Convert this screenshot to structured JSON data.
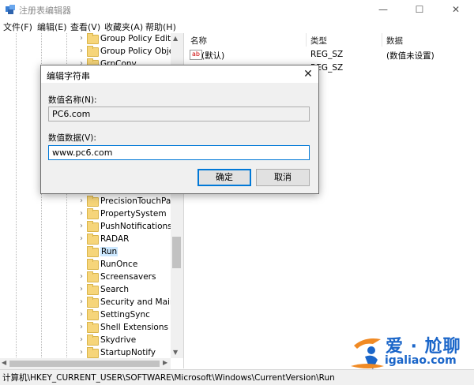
{
  "window": {
    "title": "注册表编辑器",
    "minimize_glyph": "—",
    "maximize_glyph": "☐",
    "close_glyph": "✕"
  },
  "menu": [
    "文件(F)",
    "编辑(E)",
    "查看(V)",
    "收藏夹(A)",
    "帮助(H)"
  ],
  "tree": {
    "items_top": [
      "Group Policy Editor",
      "Group Policy Objec",
      "GrpConv"
    ],
    "items_bottom": [
      {
        "label": "PrecisionTouchPad",
        "expandable": true
      },
      {
        "label": "PropertySystem",
        "expandable": true
      },
      {
        "label": "PushNotifications",
        "expandable": true
      },
      {
        "label": "RADAR",
        "expandable": true
      },
      {
        "label": "Run",
        "expandable": false,
        "selected": true
      },
      {
        "label": "RunOnce",
        "expandable": false
      },
      {
        "label": "Screensavers",
        "expandable": true
      },
      {
        "label": "Search",
        "expandable": true
      },
      {
        "label": "Security and Mainte",
        "expandable": true
      },
      {
        "label": "SettingSync",
        "expandable": true
      },
      {
        "label": "Shell Extensions",
        "expandable": true
      },
      {
        "label": "Skydrive",
        "expandable": true
      },
      {
        "label": "StartupNotify",
        "expandable": true
      }
    ]
  },
  "values": {
    "columns": [
      "名称",
      "类型",
      "数据"
    ],
    "rows": [
      {
        "name": "(默认)",
        "type": "REG_SZ",
        "data": "(数值未设置)",
        "icon": "ab-string-icon"
      },
      {
        "name": "",
        "type": "REG_SZ",
        "data": "",
        "icon": "ab-string-icon"
      }
    ]
  },
  "status_path": "计算机\\HKEY_CURRENT_USER\\SOFTWARE\\Microsoft\\Windows\\CurrentVersion\\Run",
  "dialog": {
    "title": "编辑字符串",
    "name_label": "数值名称(N):",
    "name_value": "PC6.com",
    "data_label": "数值数据(V):",
    "data_value": "www.pc6.com",
    "ok_label": "确定",
    "cancel_label": "取消"
  },
  "watermark": {
    "line1": "爱 · 尬聊",
    "line2": "igaliao.com"
  },
  "colors": {
    "accent": "#0078d7",
    "folder": "#f6d57a",
    "selection": "#cce8ff",
    "watermark_blue": "#1b66c9",
    "watermark_orange": "#f08a24"
  }
}
